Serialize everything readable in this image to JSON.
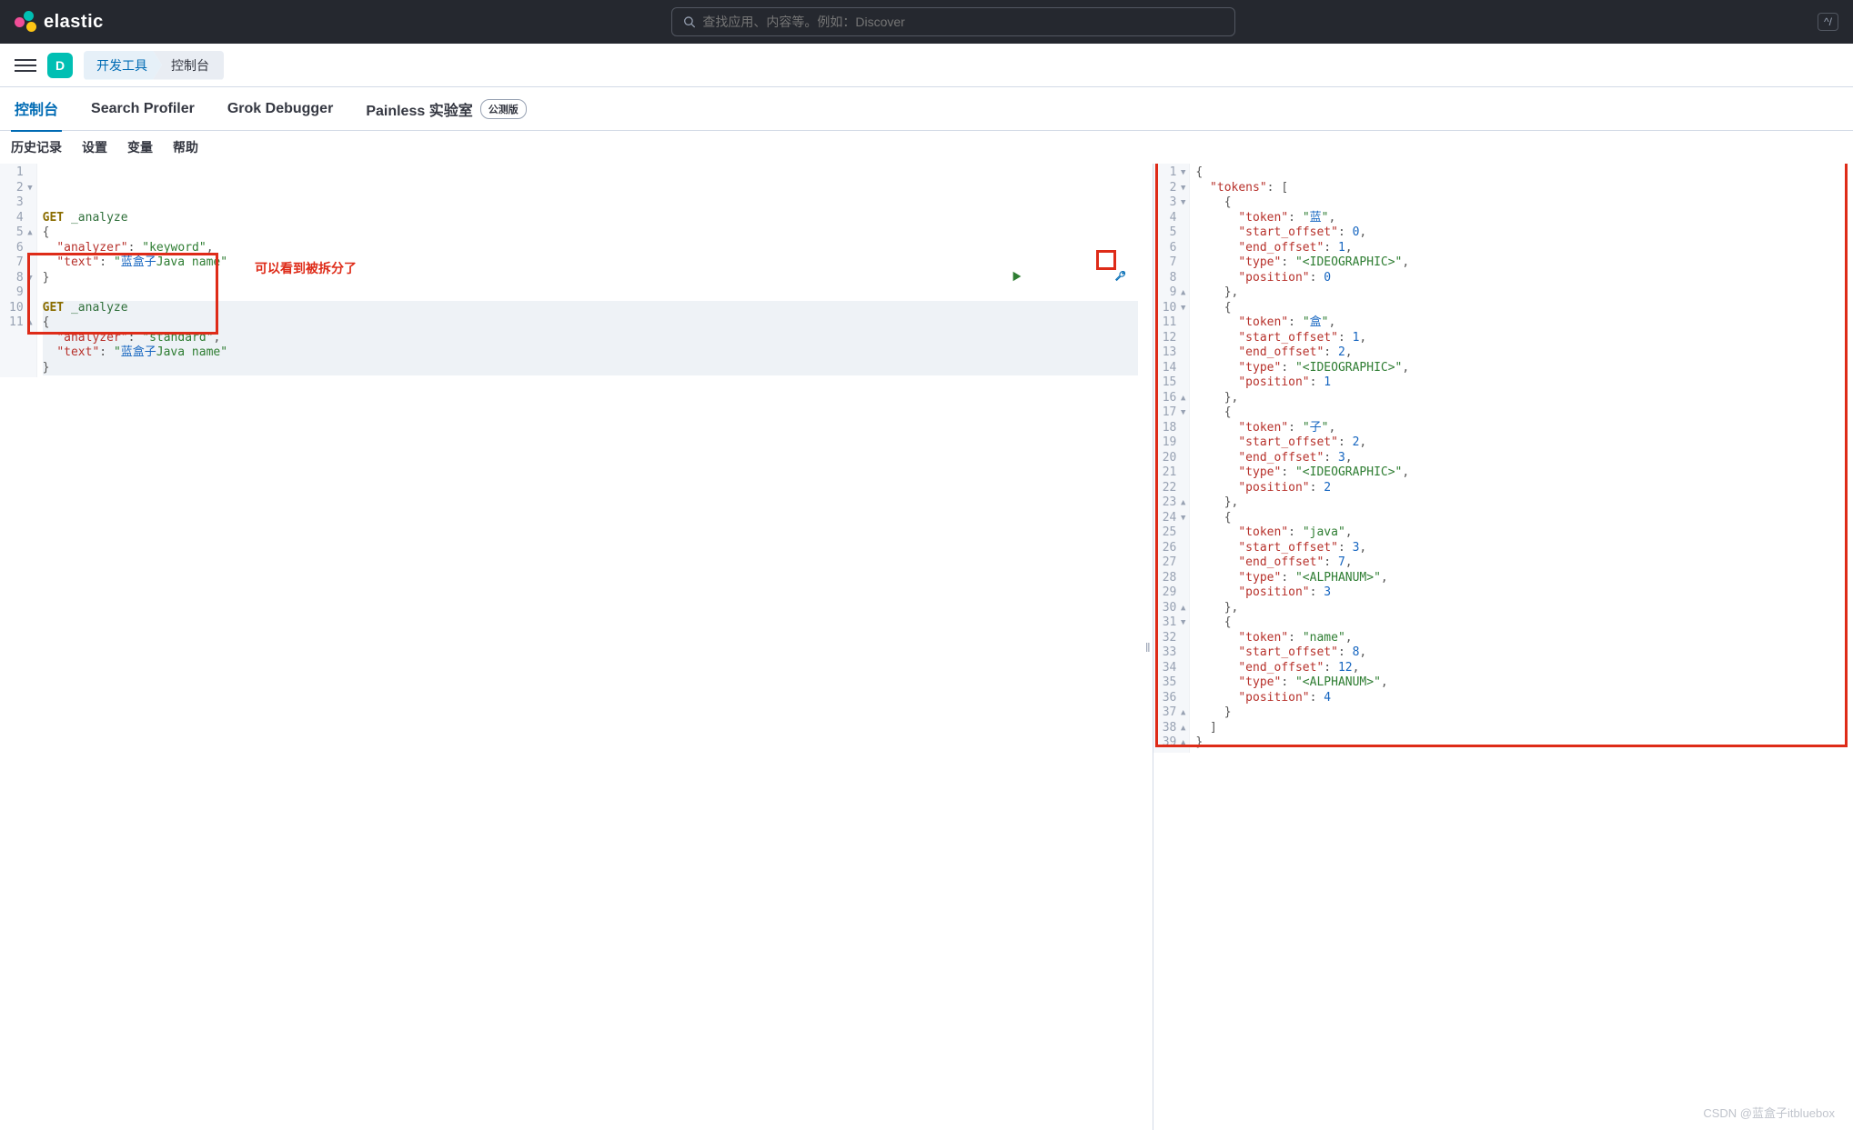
{
  "header": {
    "brand": "elastic",
    "search_placeholder": "查找应用、内容等。例如：Discover",
    "kbd_hint": "^/"
  },
  "subheader": {
    "space_letter": "D",
    "breadcrumbs": [
      "开发工具",
      "控制台"
    ]
  },
  "tabs": {
    "items": [
      "控制台",
      "Search Profiler",
      "Grok Debugger",
      "Painless 实验室"
    ],
    "beta_label": "公测版",
    "active_index": 0
  },
  "toolbar": {
    "items": [
      "历史记录",
      "设置",
      "变量",
      "帮助"
    ]
  },
  "annotations": {
    "note_text": "可以看到被拆分了"
  },
  "request_editor": {
    "lines": [
      {
        "n": 1,
        "fold": "",
        "hl": false,
        "tokens": [
          {
            "t": "GET",
            "c": "kw-method"
          },
          {
            "t": " "
          },
          {
            "t": "_analyze",
            "c": "kw-path"
          }
        ]
      },
      {
        "n": 2,
        "fold": "▼",
        "hl": false,
        "tokens": [
          {
            "t": "{",
            "c": "punct"
          }
        ]
      },
      {
        "n": 3,
        "fold": "",
        "hl": false,
        "tokens": [
          {
            "t": "  "
          },
          {
            "t": "\"analyzer\"",
            "c": "kw-key"
          },
          {
            "t": ": ",
            "c": "punct"
          },
          {
            "t": "\"keyword\"",
            "c": "kw-str"
          },
          {
            "t": ",",
            "c": "punct"
          }
        ]
      },
      {
        "n": 4,
        "fold": "",
        "hl": false,
        "tokens": [
          {
            "t": "  "
          },
          {
            "t": "\"text\"",
            "c": "kw-key"
          },
          {
            "t": ": ",
            "c": "punct"
          },
          {
            "t": "\"",
            "c": "kw-str"
          },
          {
            "t": "蓝盒子",
            "c": "kw-cjk"
          },
          {
            "t": "Java name\"",
            "c": "kw-str"
          }
        ]
      },
      {
        "n": 5,
        "fold": "▲",
        "hl": false,
        "tokens": [
          {
            "t": "}",
            "c": "punct"
          }
        ]
      },
      {
        "n": 6,
        "fold": "",
        "hl": false,
        "tokens": []
      },
      {
        "n": 7,
        "fold": "",
        "hl": true,
        "tokens": [
          {
            "t": "GET",
            "c": "kw-method"
          },
          {
            "t": " "
          },
          {
            "t": "_analyze",
            "c": "kw-path"
          }
        ]
      },
      {
        "n": 8,
        "fold": "▼",
        "hl": true,
        "tokens": [
          {
            "t": "{",
            "c": "punct"
          }
        ]
      },
      {
        "n": 9,
        "fold": "",
        "hl": true,
        "tokens": [
          {
            "t": "  "
          },
          {
            "t": "\"analyzer\"",
            "c": "kw-key"
          },
          {
            "t": ": ",
            "c": "punct"
          },
          {
            "t": "\"standard\"",
            "c": "kw-str"
          },
          {
            "t": ",",
            "c": "punct"
          }
        ]
      },
      {
        "n": 10,
        "fold": "",
        "hl": true,
        "tokens": [
          {
            "t": "  "
          },
          {
            "t": "\"text\"",
            "c": "kw-key"
          },
          {
            "t": ": ",
            "c": "punct"
          },
          {
            "t": "\"",
            "c": "kw-str"
          },
          {
            "t": "蓝盒子",
            "c": "kw-cjk"
          },
          {
            "t": "Java name\"",
            "c": "kw-str"
          }
        ]
      },
      {
        "n": 11,
        "fold": "▲",
        "hl": true,
        "tokens": [
          {
            "t": "}",
            "c": "punct"
          }
        ]
      }
    ]
  },
  "response_editor": {
    "lines": [
      {
        "n": 1,
        "fold": "▼",
        "tokens": [
          {
            "t": "{",
            "c": "punct"
          }
        ]
      },
      {
        "n": 2,
        "fold": "▼",
        "tokens": [
          {
            "t": "  "
          },
          {
            "t": "\"tokens\"",
            "c": "kw-key"
          },
          {
            "t": ": [",
            "c": "punct"
          }
        ]
      },
      {
        "n": 3,
        "fold": "▼",
        "tokens": [
          {
            "t": "    {",
            "c": "punct"
          }
        ]
      },
      {
        "n": 4,
        "fold": "",
        "tokens": [
          {
            "t": "      "
          },
          {
            "t": "\"token\"",
            "c": "kw-key"
          },
          {
            "t": ": ",
            "c": "punct"
          },
          {
            "t": "\"",
            "c": "kw-str"
          },
          {
            "t": "蓝",
            "c": "kw-cjk"
          },
          {
            "t": "\"",
            "c": "kw-str"
          },
          {
            "t": ",",
            "c": "punct"
          }
        ]
      },
      {
        "n": 5,
        "fold": "",
        "tokens": [
          {
            "t": "      "
          },
          {
            "t": "\"start_offset\"",
            "c": "kw-key"
          },
          {
            "t": ": ",
            "c": "punct"
          },
          {
            "t": "0",
            "c": "kw-num"
          },
          {
            "t": ",",
            "c": "punct"
          }
        ]
      },
      {
        "n": 6,
        "fold": "",
        "tokens": [
          {
            "t": "      "
          },
          {
            "t": "\"end_offset\"",
            "c": "kw-key"
          },
          {
            "t": ": ",
            "c": "punct"
          },
          {
            "t": "1",
            "c": "kw-num"
          },
          {
            "t": ",",
            "c": "punct"
          }
        ]
      },
      {
        "n": 7,
        "fold": "",
        "tokens": [
          {
            "t": "      "
          },
          {
            "t": "\"type\"",
            "c": "kw-key"
          },
          {
            "t": ": ",
            "c": "punct"
          },
          {
            "t": "\"<IDEOGRAPHIC>\"",
            "c": "kw-str"
          },
          {
            "t": ",",
            "c": "punct"
          }
        ]
      },
      {
        "n": 8,
        "fold": "",
        "tokens": [
          {
            "t": "      "
          },
          {
            "t": "\"position\"",
            "c": "kw-key"
          },
          {
            "t": ": ",
            "c": "punct"
          },
          {
            "t": "0",
            "c": "kw-num"
          }
        ]
      },
      {
        "n": 9,
        "fold": "▲",
        "tokens": [
          {
            "t": "    },",
            "c": "punct"
          }
        ]
      },
      {
        "n": 10,
        "fold": "▼",
        "tokens": [
          {
            "t": "    {",
            "c": "punct"
          }
        ]
      },
      {
        "n": 11,
        "fold": "",
        "tokens": [
          {
            "t": "      "
          },
          {
            "t": "\"token\"",
            "c": "kw-key"
          },
          {
            "t": ": ",
            "c": "punct"
          },
          {
            "t": "\"",
            "c": "kw-str"
          },
          {
            "t": "盒",
            "c": "kw-cjk"
          },
          {
            "t": "\"",
            "c": "kw-str"
          },
          {
            "t": ",",
            "c": "punct"
          }
        ]
      },
      {
        "n": 12,
        "fold": "",
        "tokens": [
          {
            "t": "      "
          },
          {
            "t": "\"start_offset\"",
            "c": "kw-key"
          },
          {
            "t": ": ",
            "c": "punct"
          },
          {
            "t": "1",
            "c": "kw-num"
          },
          {
            "t": ",",
            "c": "punct"
          }
        ]
      },
      {
        "n": 13,
        "fold": "",
        "tokens": [
          {
            "t": "      "
          },
          {
            "t": "\"end_offset\"",
            "c": "kw-key"
          },
          {
            "t": ": ",
            "c": "punct"
          },
          {
            "t": "2",
            "c": "kw-num"
          },
          {
            "t": ",",
            "c": "punct"
          }
        ]
      },
      {
        "n": 14,
        "fold": "",
        "tokens": [
          {
            "t": "      "
          },
          {
            "t": "\"type\"",
            "c": "kw-key"
          },
          {
            "t": ": ",
            "c": "punct"
          },
          {
            "t": "\"<IDEOGRAPHIC>\"",
            "c": "kw-str"
          },
          {
            "t": ",",
            "c": "punct"
          }
        ]
      },
      {
        "n": 15,
        "fold": "",
        "tokens": [
          {
            "t": "      "
          },
          {
            "t": "\"position\"",
            "c": "kw-key"
          },
          {
            "t": ": ",
            "c": "punct"
          },
          {
            "t": "1",
            "c": "kw-num"
          }
        ]
      },
      {
        "n": 16,
        "fold": "▲",
        "tokens": [
          {
            "t": "    },",
            "c": "punct"
          }
        ]
      },
      {
        "n": 17,
        "fold": "▼",
        "tokens": [
          {
            "t": "    {",
            "c": "punct"
          }
        ]
      },
      {
        "n": 18,
        "fold": "",
        "tokens": [
          {
            "t": "      "
          },
          {
            "t": "\"token\"",
            "c": "kw-key"
          },
          {
            "t": ": ",
            "c": "punct"
          },
          {
            "t": "\"",
            "c": "kw-str"
          },
          {
            "t": "子",
            "c": "kw-cjk"
          },
          {
            "t": "\"",
            "c": "kw-str"
          },
          {
            "t": ",",
            "c": "punct"
          }
        ]
      },
      {
        "n": 19,
        "fold": "",
        "tokens": [
          {
            "t": "      "
          },
          {
            "t": "\"start_offset\"",
            "c": "kw-key"
          },
          {
            "t": ": ",
            "c": "punct"
          },
          {
            "t": "2",
            "c": "kw-num"
          },
          {
            "t": ",",
            "c": "punct"
          }
        ]
      },
      {
        "n": 20,
        "fold": "",
        "tokens": [
          {
            "t": "      "
          },
          {
            "t": "\"end_offset\"",
            "c": "kw-key"
          },
          {
            "t": ": ",
            "c": "punct"
          },
          {
            "t": "3",
            "c": "kw-num"
          },
          {
            "t": ",",
            "c": "punct"
          }
        ]
      },
      {
        "n": 21,
        "fold": "",
        "tokens": [
          {
            "t": "      "
          },
          {
            "t": "\"type\"",
            "c": "kw-key"
          },
          {
            "t": ": ",
            "c": "punct"
          },
          {
            "t": "\"<IDEOGRAPHIC>\"",
            "c": "kw-str"
          },
          {
            "t": ",",
            "c": "punct"
          }
        ]
      },
      {
        "n": 22,
        "fold": "",
        "tokens": [
          {
            "t": "      "
          },
          {
            "t": "\"position\"",
            "c": "kw-key"
          },
          {
            "t": ": ",
            "c": "punct"
          },
          {
            "t": "2",
            "c": "kw-num"
          }
        ]
      },
      {
        "n": 23,
        "fold": "▲",
        "tokens": [
          {
            "t": "    },",
            "c": "punct"
          }
        ]
      },
      {
        "n": 24,
        "fold": "▼",
        "tokens": [
          {
            "t": "    {",
            "c": "punct"
          }
        ]
      },
      {
        "n": 25,
        "fold": "",
        "tokens": [
          {
            "t": "      "
          },
          {
            "t": "\"token\"",
            "c": "kw-key"
          },
          {
            "t": ": ",
            "c": "punct"
          },
          {
            "t": "\"java\"",
            "c": "kw-str"
          },
          {
            "t": ",",
            "c": "punct"
          }
        ]
      },
      {
        "n": 26,
        "fold": "",
        "tokens": [
          {
            "t": "      "
          },
          {
            "t": "\"start_offset\"",
            "c": "kw-key"
          },
          {
            "t": ": ",
            "c": "punct"
          },
          {
            "t": "3",
            "c": "kw-num"
          },
          {
            "t": ",",
            "c": "punct"
          }
        ]
      },
      {
        "n": 27,
        "fold": "",
        "tokens": [
          {
            "t": "      "
          },
          {
            "t": "\"end_offset\"",
            "c": "kw-key"
          },
          {
            "t": ": ",
            "c": "punct"
          },
          {
            "t": "7",
            "c": "kw-num"
          },
          {
            "t": ",",
            "c": "punct"
          }
        ]
      },
      {
        "n": 28,
        "fold": "",
        "tokens": [
          {
            "t": "      "
          },
          {
            "t": "\"type\"",
            "c": "kw-key"
          },
          {
            "t": ": ",
            "c": "punct"
          },
          {
            "t": "\"<ALPHANUM>\"",
            "c": "kw-str"
          },
          {
            "t": ",",
            "c": "punct"
          }
        ]
      },
      {
        "n": 29,
        "fold": "",
        "tokens": [
          {
            "t": "      "
          },
          {
            "t": "\"position\"",
            "c": "kw-key"
          },
          {
            "t": ": ",
            "c": "punct"
          },
          {
            "t": "3",
            "c": "kw-num"
          }
        ]
      },
      {
        "n": 30,
        "fold": "▲",
        "tokens": [
          {
            "t": "    },",
            "c": "punct"
          }
        ]
      },
      {
        "n": 31,
        "fold": "▼",
        "tokens": [
          {
            "t": "    {",
            "c": "punct"
          }
        ]
      },
      {
        "n": 32,
        "fold": "",
        "tokens": [
          {
            "t": "      "
          },
          {
            "t": "\"token\"",
            "c": "kw-key"
          },
          {
            "t": ": ",
            "c": "punct"
          },
          {
            "t": "\"name\"",
            "c": "kw-str"
          },
          {
            "t": ",",
            "c": "punct"
          }
        ]
      },
      {
        "n": 33,
        "fold": "",
        "tokens": [
          {
            "t": "      "
          },
          {
            "t": "\"start_offset\"",
            "c": "kw-key"
          },
          {
            "t": ": ",
            "c": "punct"
          },
          {
            "t": "8",
            "c": "kw-num"
          },
          {
            "t": ",",
            "c": "punct"
          }
        ]
      },
      {
        "n": 34,
        "fold": "",
        "tokens": [
          {
            "t": "      "
          },
          {
            "t": "\"end_offset\"",
            "c": "kw-key"
          },
          {
            "t": ": ",
            "c": "punct"
          },
          {
            "t": "12",
            "c": "kw-num"
          },
          {
            "t": ",",
            "c": "punct"
          }
        ]
      },
      {
        "n": 35,
        "fold": "",
        "tokens": [
          {
            "t": "      "
          },
          {
            "t": "\"type\"",
            "c": "kw-key"
          },
          {
            "t": ": ",
            "c": "punct"
          },
          {
            "t": "\"<ALPHANUM>\"",
            "c": "kw-str"
          },
          {
            "t": ",",
            "c": "punct"
          }
        ]
      },
      {
        "n": 36,
        "fold": "",
        "tokens": [
          {
            "t": "      "
          },
          {
            "t": "\"position\"",
            "c": "kw-key"
          },
          {
            "t": ": ",
            "c": "punct"
          },
          {
            "t": "4",
            "c": "kw-num"
          }
        ]
      },
      {
        "n": 37,
        "fold": "▲",
        "tokens": [
          {
            "t": "    }",
            "c": "punct"
          }
        ]
      },
      {
        "n": 38,
        "fold": "▲",
        "tokens": [
          {
            "t": "  ]",
            "c": "punct"
          }
        ]
      },
      {
        "n": 39,
        "fold": "▲",
        "tokens": [
          {
            "t": "}",
            "c": "punct"
          }
        ]
      }
    ]
  },
  "watermark": "CSDN @蓝盒子itbluebox"
}
